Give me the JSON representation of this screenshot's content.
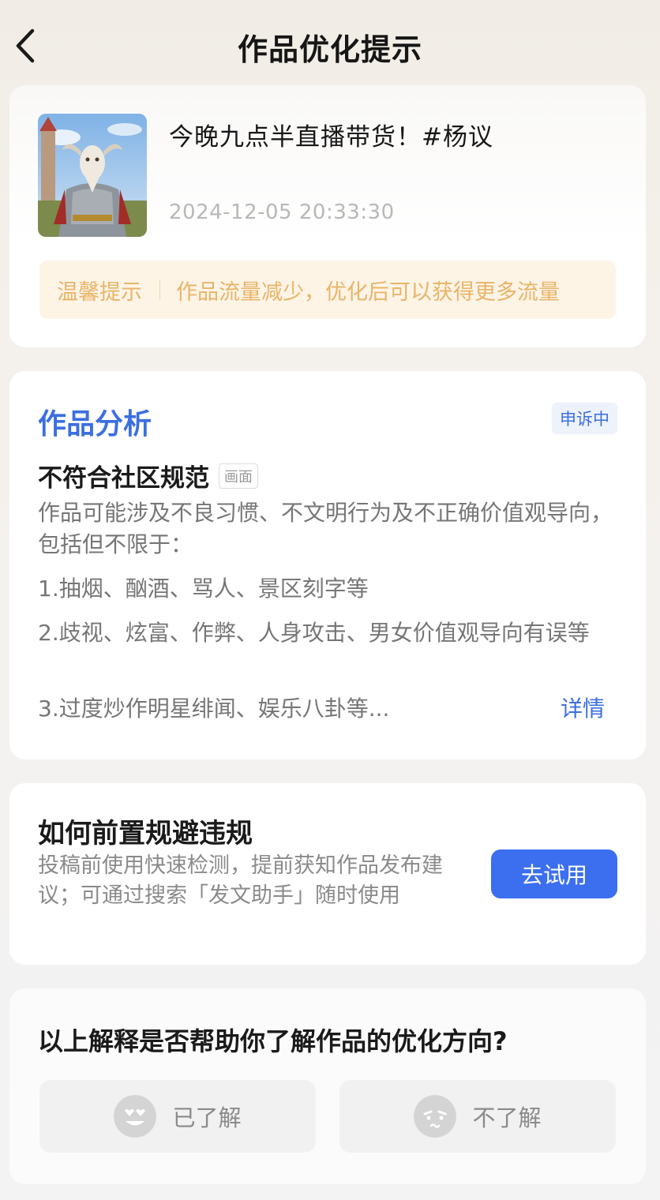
{
  "header": {
    "title": "作品优化提示",
    "back_icon": "back-arrow-icon"
  },
  "video": {
    "title": "今晚九点半直播带货！#杨议",
    "timestamp": "2024-12-05 20:33:30",
    "tip_label": "温馨提示",
    "tip_text": "作品流量减少，优化后可以获得更多流量"
  },
  "analysis": {
    "title": "作品分析",
    "status": "申诉中",
    "violation_title": "不符合社区规范",
    "violation_tag": "画面",
    "description": "作品可能涉及不良习惯、不文明行为及不正确价值观导向，包括但不限于：",
    "items": [
      "1.抽烟、酗酒、骂人、景区刻字等",
      "2.歧视、炫富、作弊、人身攻击、男女价值观导向有误等",
      "3.过度炒作明星绯闻、娱乐八卦等..."
    ],
    "detail_label": "详情"
  },
  "avoid": {
    "title": "如何前置规避违规",
    "description": "投稿前使用快速检测，提前获知作品发布建议；可通过搜索「发文助手」随时使用",
    "button_label": "去试用"
  },
  "feedback": {
    "question": "以上解释是否帮助你了解作品的优化方向?",
    "yes_label": "已了解",
    "no_label": "不了解"
  },
  "colors": {
    "accent": "#3b6fe0",
    "button": "#3b6ff0",
    "tip_text": "#e9b468",
    "tip_bg": "#fdf4e6"
  }
}
